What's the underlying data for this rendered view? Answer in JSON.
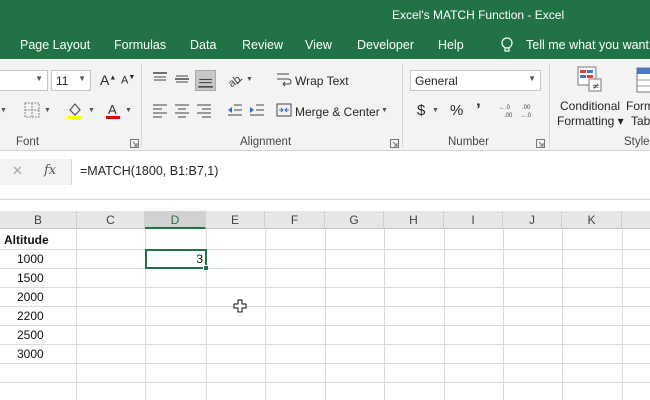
{
  "window": {
    "title": "Excel's MATCH Function  -  Excel"
  },
  "tabs": [
    "Page Layout",
    "Formulas",
    "Data",
    "Review",
    "View",
    "Developer",
    "Help"
  ],
  "tell_me": "Tell me what you want",
  "ribbon": {
    "font": {
      "size": "11",
      "group_label": "Font"
    },
    "alignment": {
      "wrap_text": "Wrap Text",
      "merge_center": "Merge & Center",
      "group_label": "Alignment"
    },
    "number": {
      "format": "General",
      "currency": "$",
      "percent": "%",
      "comma": "’",
      "group_label": "Number"
    },
    "styles": {
      "conditional_formatting_1": "Conditional",
      "conditional_formatting_2": "Formatting ▾",
      "format_table_1": "Form",
      "format_table_2": "Tab",
      "group_label": "Styles"
    }
  },
  "formula_bar": {
    "cancel": "✕",
    "fx": "fx",
    "formula": "=MATCH(1800, B1:B7,1)"
  },
  "columns": [
    "B",
    "C",
    "D",
    "E",
    "F",
    "G",
    "H",
    "I",
    "J",
    "K"
  ],
  "active_column": "D",
  "cells": {
    "header": "Altitude",
    "altitudes": [
      "1000",
      "1500",
      "2000",
      "2200",
      "2500",
      "3000"
    ],
    "result": "3"
  },
  "colors": {
    "brand": "#217346",
    "selection": "#217346"
  }
}
